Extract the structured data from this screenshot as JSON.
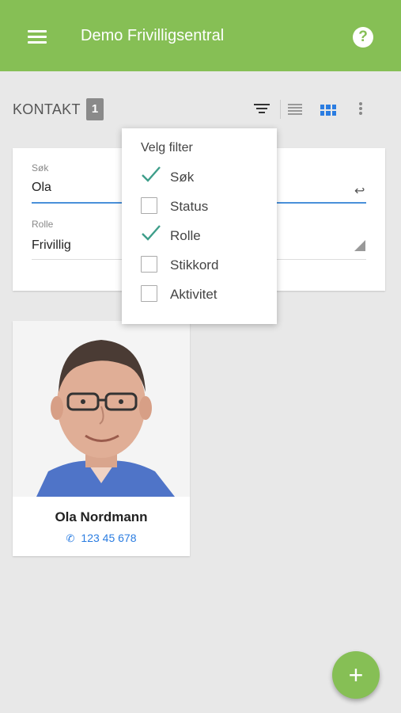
{
  "appbar": {
    "title": "Demo Frivilligsentral",
    "menu_icon": "hamburger-menu-icon",
    "help_icon": "help-icon",
    "help_glyph": "?",
    "color": "#86bf55"
  },
  "section": {
    "title": "KONTAKT",
    "count": "1"
  },
  "toolbar": {
    "icons": [
      "filter-icon",
      "list-view-icon",
      "grid-view-icon",
      "more-vert-icon"
    ],
    "active_view_color": "#2b7de1"
  },
  "filters": {
    "search_label": "Søk",
    "search_value": "Ola",
    "enter_glyph": "↩",
    "role_label": "Rolle",
    "role_value": "Frivillig"
  },
  "filter_menu": {
    "title": "Velg filter",
    "items": [
      {
        "label": "Søk",
        "checked": true
      },
      {
        "label": "Status",
        "checked": false
      },
      {
        "label": "Rolle",
        "checked": true
      },
      {
        "label": "Stikkord",
        "checked": false
      },
      {
        "label": "Aktivitet",
        "checked": false
      }
    ]
  },
  "contacts": [
    {
      "name": "Ola Nordmann",
      "phone": "123 45 678"
    }
  ],
  "fab": {
    "glyph": "+"
  }
}
